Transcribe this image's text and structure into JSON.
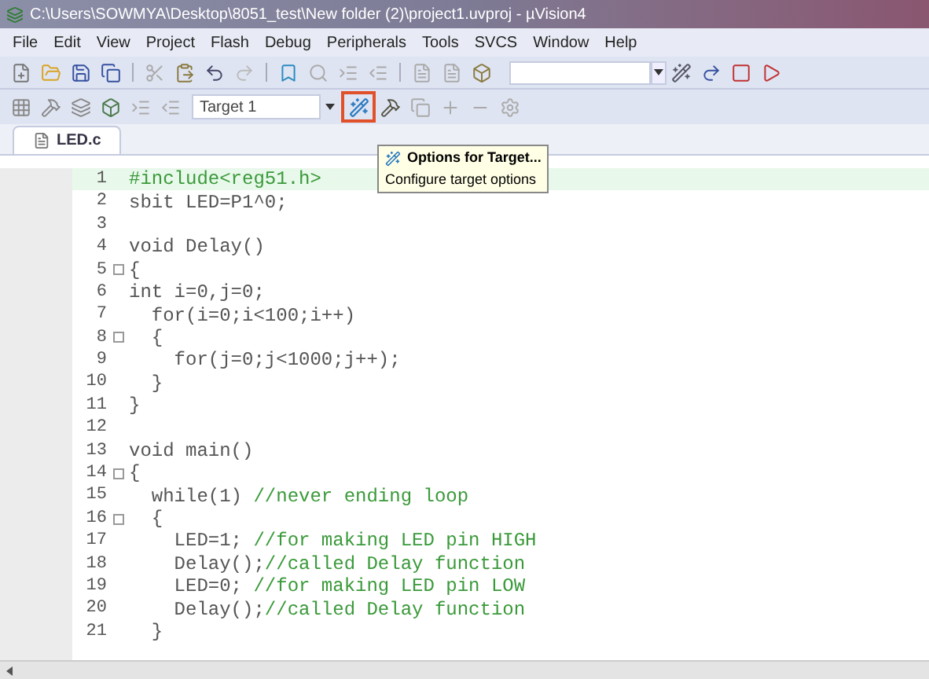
{
  "window": {
    "title": "C:\\Users\\SOWMYA\\Desktop\\8051_test\\New folder (2)\\project1.uvproj - µVision4"
  },
  "menu": [
    "File",
    "Edit",
    "View",
    "Project",
    "Flash",
    "Debug",
    "Peripherals",
    "Tools",
    "SVCS",
    "Window",
    "Help"
  ],
  "toolbar": {
    "target": "Target 1",
    "options_button": {
      "highlighted": true
    }
  },
  "tabs": [
    {
      "label": "LED.c",
      "selected": true
    }
  ],
  "tooltip": {
    "title": "Options for Target...",
    "description": "Configure target options"
  },
  "editor": {
    "lines": [
      {
        "number": "1",
        "code": "#include<reg51.h>",
        "kind": "preprocessor",
        "current": true
      },
      {
        "number": "2",
        "code": "sbit LED=P1^0;",
        "kind": "code",
        "current": false
      },
      {
        "number": "3",
        "current": false
      },
      {
        "number": "4",
        "code": "void Delay()",
        "kind": "code",
        "current": false
      },
      {
        "number": "5",
        "code": "{",
        "kind": "code",
        "current": false,
        "fold": true
      },
      {
        "number": "6",
        "code": "int i=0,j=0;",
        "kind": "code",
        "current": false
      },
      {
        "number": "7",
        "code": "  for(i=0;i<100;i++)",
        "kind": "code",
        "current": false
      },
      {
        "number": "8",
        "code": "  {",
        "kind": "code",
        "current": false,
        "fold": true
      },
      {
        "number": "9",
        "code": "    for(j=0;j<1000;j++);",
        "kind": "code",
        "current": false
      },
      {
        "number": "10",
        "code": "  }",
        "kind": "code",
        "current": false
      },
      {
        "number": "11",
        "code": "}",
        "kind": "code",
        "current": false
      },
      {
        "number": "12",
        "current": false
      },
      {
        "number": "13",
        "code": "void main()",
        "kind": "code",
        "current": false
      },
      {
        "number": "14",
        "code": "{",
        "kind": "code",
        "current": false,
        "fold": true
      },
      {
        "number": "15",
        "code": "  while(1) ",
        "comment": "//never ending loop",
        "kind": "code",
        "current": false
      },
      {
        "number": "16",
        "code": "  {",
        "kind": "code",
        "current": false,
        "fold": true
      },
      {
        "number": "17",
        "code": "    LED=1; ",
        "comment": "//for making LED pin HIGH",
        "kind": "code",
        "current": false
      },
      {
        "number": "18",
        "code": "    Delay();",
        "comment": "//called Delay function",
        "kind": "code",
        "current": false
      },
      {
        "number": "19",
        "code": "    LED=0; ",
        "comment": "//for making LED pin LOW",
        "kind": "code",
        "current": false
      },
      {
        "number": "20",
        "code": "    Delay();",
        "comment": "//called Delay function",
        "kind": "code",
        "current": false
      },
      {
        "number": "21",
        "code": "  }",
        "kind": "code",
        "current": false
      }
    ]
  }
}
